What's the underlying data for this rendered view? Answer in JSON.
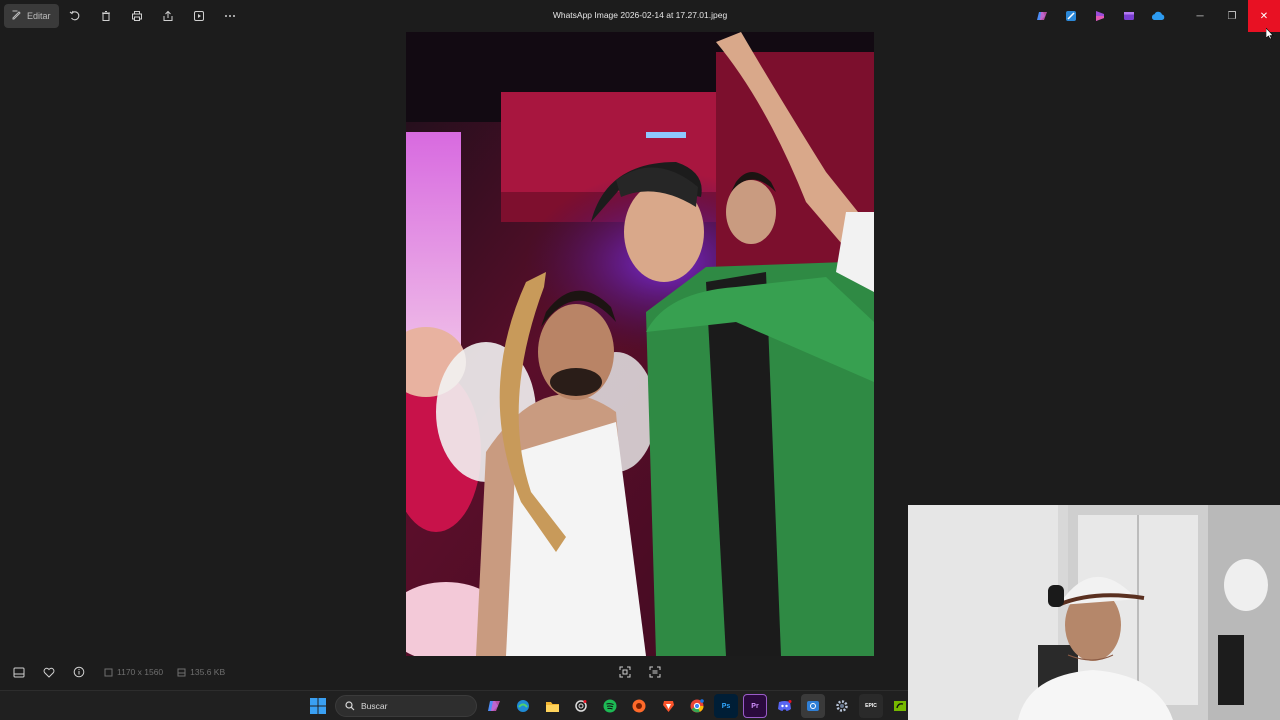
{
  "window": {
    "title": "WhatsApp Image 2026-02-14 at 17.27.01.jpeg",
    "toolbar": {
      "edit_label": "Editar",
      "tools": [
        {
          "icon": "rotate-icon"
        },
        {
          "icon": "trash-icon"
        },
        {
          "icon": "print-icon"
        },
        {
          "icon": "share-icon"
        },
        {
          "icon": "slideshow-icon"
        },
        {
          "icon": "more-icon"
        }
      ]
    },
    "tray_apps": [
      "copilot-icon",
      "designer-icon",
      "clipchamp-icon",
      "clipchamp-video-icon",
      "onedrive-icon"
    ],
    "controls": {
      "minimize": "─",
      "restore": "❐",
      "close": "✕"
    }
  },
  "bottombar": {
    "dimensions": "1170 x 1560",
    "file_size": "135.6 KB",
    "left_icons": [
      "filmstrip-icon",
      "heart-icon",
      "info-icon"
    ],
    "center_icons": [
      "fit-screen-icon",
      "ocr-icon"
    ]
  },
  "taskbar": {
    "search_placeholder": "Buscar",
    "apps": [
      {
        "name": "copilot",
        "color": "#7b61ff"
      },
      {
        "name": "edge",
        "color": "#1f8bd6"
      },
      {
        "name": "file-explorer",
        "color": "#f2b533"
      },
      {
        "name": "chatgpt",
        "color": "#444444"
      },
      {
        "name": "spotify",
        "color": "#1db954"
      },
      {
        "name": "firefox-like",
        "color": "#ff6a2a"
      },
      {
        "name": "brave",
        "color": "#fb542b"
      },
      {
        "name": "chrome",
        "color": "#34a853"
      },
      {
        "name": "photoshop",
        "label": "Ps",
        "color": "#001e36"
      },
      {
        "name": "premiere",
        "label": "Pr",
        "color": "#2a0a3d"
      },
      {
        "name": "discord",
        "color": "#5865f2"
      },
      {
        "name": "photos",
        "color": "#2f7fd6"
      },
      {
        "name": "settings",
        "color": "#6b6b6b"
      },
      {
        "name": "epic-games",
        "label": "EPIC",
        "color": "#2a2a2a"
      },
      {
        "name": "nvidia",
        "color": "#76b900"
      }
    ]
  },
  "colors": {
    "background": "#1c1c1c",
    "close": "#e81123",
    "taskbar": "#202020"
  }
}
